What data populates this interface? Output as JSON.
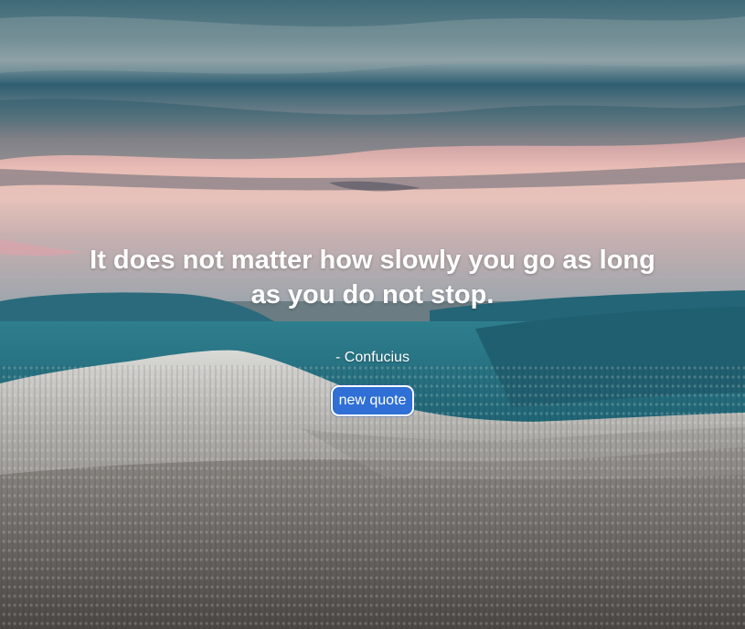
{
  "quote": {
    "text": "It does not matter how slowly you go as long as you do not stop.",
    "author": "- Confucius"
  },
  "button": {
    "label": "new quote"
  },
  "background": {
    "description_icon": "mountain-landscape-image"
  },
  "colors": {
    "button_bg": "#2f6fd6",
    "text": "#ffffff"
  }
}
